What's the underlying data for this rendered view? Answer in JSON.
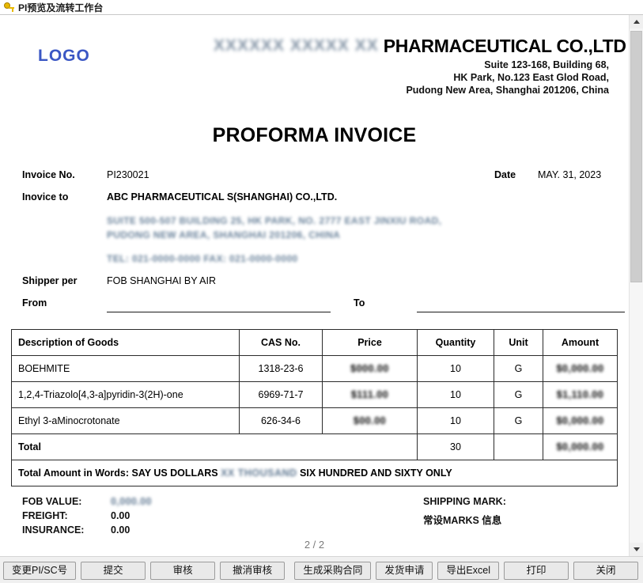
{
  "window": {
    "title": "PI预览及流转工作台",
    "icon": "key-icon"
  },
  "letterhead": {
    "logo_text": "LOGO",
    "company_prefix_redacted": "XXXXXX XXXXX XX",
    "company_name": "PHARMACEUTICAL CO.,LTD",
    "address_lines": [
      "Suite 123-168, Building 68,",
      "HK Park, No.123 East Glod Road,",
      "Pudong New Area, Shanghai 201206, China"
    ]
  },
  "document": {
    "title": "PROFORMA INVOICE",
    "page_indicator": "2 / 2"
  },
  "meta": {
    "invoice_no_label": "Invoice  No.",
    "invoice_no_value": "PI230021",
    "date_label": "Date",
    "date_value": "MAY. 31, 2023",
    "invoice_to_label": "Inovice to",
    "invoice_to_value": "ABC PHARMACEUTICAL S(SHANGHAI) CO.,LTD.",
    "invoice_to_address_redacted": [
      "SUITE 500-507 BUILDING 25, HK PARK, NO. 2777 EAST JINXIU ROAD,",
      "PUDONG NEW AREA, SHANGHAI 201206, CHINA",
      "TEL: 021-0000-0000   FAX: 021-0000-0000"
    ],
    "shipper_per_label": "Shipper per",
    "shipper_per_value": "FOB SHANGHAI BY AIR",
    "from_label": "From",
    "from_value": "",
    "to_label": "To",
    "to_value": ""
  },
  "goods_table": {
    "columns": [
      "Description of Goods",
      "CAS No.",
      "Price",
      "Quantity",
      "Unit",
      "Amount"
    ],
    "rows": [
      {
        "description": "BOEHMITE",
        "cas": "1318-23-6",
        "price": "$000.00",
        "quantity": "10",
        "unit": "G",
        "amount": "$0,000.00"
      },
      {
        "description": "1,2,4-Triazolo[4,3-a]pyridin-3(2H)-one",
        "cas": "6969-71-7",
        "price": "$111.00",
        "quantity": "10",
        "unit": "G",
        "amount": "$1,110.00"
      },
      {
        "description": "Ethyl 3-aMinocrotonate",
        "cas": "626-34-6",
        "price": "$00.00",
        "quantity": "10",
        "unit": "G",
        "amount": "$0,000.00"
      }
    ],
    "total_label": "Total",
    "total_quantity": "30",
    "total_amount": "$0,000.00",
    "words_label": "Total Amount in Words:",
    "words_prefix": "SAY US DOLLARS",
    "words_redacted": "XX THOUSAND",
    "words_suffix": "SIX HUNDRED AND SIXTY  ONLY"
  },
  "footer": {
    "fob_label": "FOB VALUE:",
    "fob_value": "0,000.00",
    "freight_label": "FREIGHT:",
    "freight_value": "0.00",
    "insurance_label": "INSURANCE:",
    "insurance_value": "0.00",
    "shipping_mark_label": "SHIPPING MARK:",
    "shipping_mark_value": "常设MARKS 信息"
  },
  "toolbar": {
    "left_buttons": [
      {
        "label": "变更PI/SC号"
      },
      {
        "label": "提交"
      },
      {
        "label": "审核"
      },
      {
        "label": "撤消审核"
      }
    ],
    "right_buttons": [
      {
        "label": "生成采购合同"
      },
      {
        "label": "发货申请"
      },
      {
        "label": "导出Excel"
      },
      {
        "label": "打印"
      },
      {
        "label": "关闭"
      }
    ]
  },
  "scrollbar": {
    "up_arrow": "chevron-up-icon",
    "down_arrow": "chevron-down-icon"
  }
}
